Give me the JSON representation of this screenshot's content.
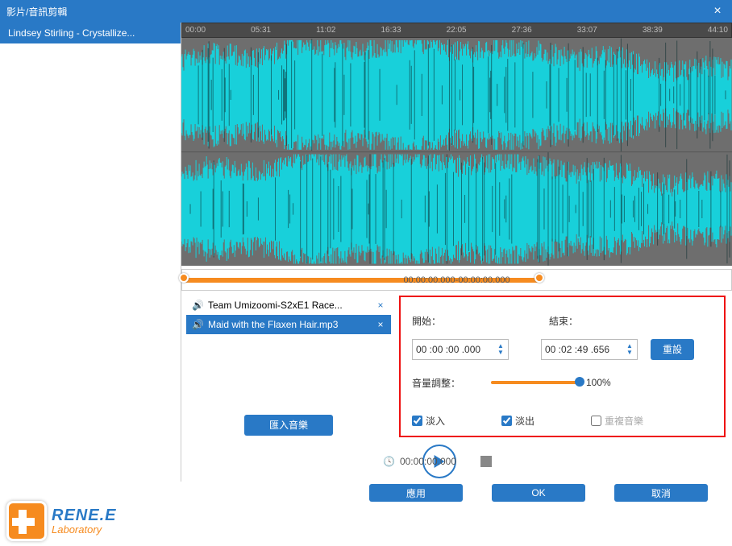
{
  "window": {
    "title": "影片/音訊剪輯"
  },
  "sidebar": {
    "items": [
      {
        "label": "Lindsey Stirling - Crystallize..."
      }
    ]
  },
  "ruler": [
    "00:00",
    "05:31",
    "11:02",
    "16:33",
    "22:05",
    "27:36",
    "33:07",
    "38:39",
    "44:10"
  ],
  "trim": {
    "range_label": "00:00:00.000-00:00:00.000"
  },
  "tracks": [
    {
      "name": "Team Umizoomi-S2xE1 Race...",
      "selected": false
    },
    {
      "name": "Maid with the Flaxen Hair.mp3",
      "selected": true
    }
  ],
  "import_button": "匯入音樂",
  "settings": {
    "start_label": "開始：",
    "end_label": "結束：",
    "start_value": "00 :00 :00 .000",
    "end_value": "00 :02 :49 .656",
    "reset_label": "重設",
    "volume_label": "音量調整：",
    "volume_value": "100%",
    "fade_in_label": "淡入",
    "fade_out_label": "淡出",
    "repeat_label": "重複音樂",
    "fade_in_checked": true,
    "fade_out_checked": true,
    "repeat_checked": false
  },
  "playbar": {
    "time": "00:00:00.000"
  },
  "footer": {
    "apply": "應用",
    "ok": "OK",
    "cancel": "取消"
  },
  "logo": {
    "line1": "RENE.E",
    "line2": "Laboratory"
  }
}
